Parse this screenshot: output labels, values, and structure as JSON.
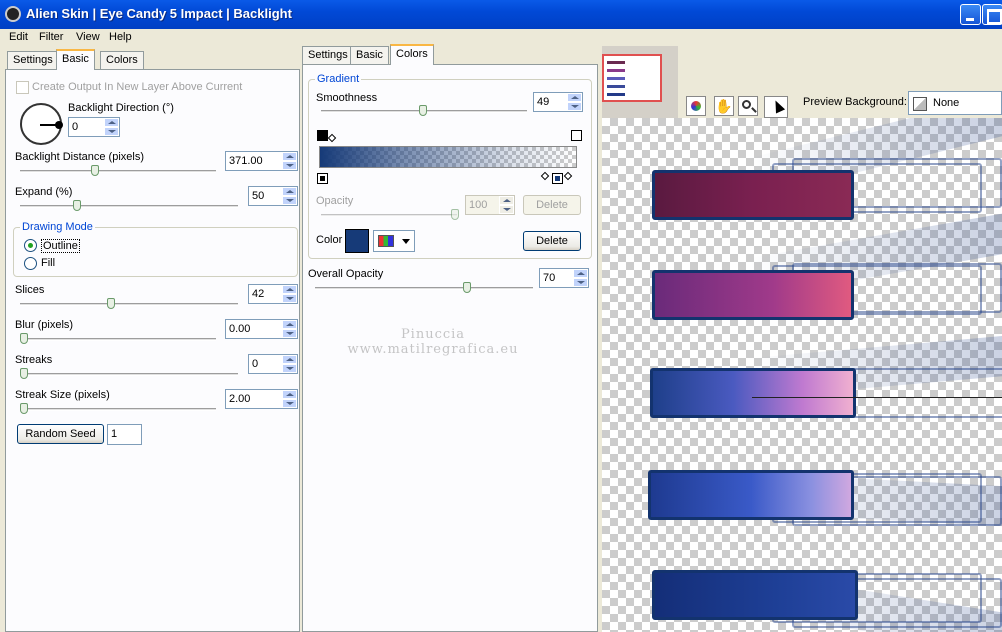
{
  "window": {
    "title": "Alien Skin  |  Eye Candy 5 Impact  |  Backlight"
  },
  "menu": [
    "Edit",
    "Filter",
    "View",
    "Help"
  ],
  "left_tabs": [
    "Settings",
    "Basic",
    "Colors"
  ],
  "right_tabs": [
    "Settings",
    "Basic",
    "Colors"
  ],
  "basic": {
    "create_output_label": "Create Output In New Layer Above Current",
    "direction_label": "Backlight Direction (°)",
    "direction_value": "0",
    "distance_label": "Backlight Distance (pixels)",
    "distance_value": "371.00",
    "expand_label": "Expand (%)",
    "expand_value": "50",
    "drawing_mode_title": "Drawing Mode",
    "outline_label": "Outline",
    "fill_label": "Fill",
    "slices_label": "Slices",
    "slices_value": "42",
    "blur_label": "Blur (pixels)",
    "blur_value": "0.00",
    "streaks_label": "Streaks",
    "streaks_value": "0",
    "streak_size_label": "Streak Size (pixels)",
    "streak_size_value": "2.00",
    "random_seed_label": "Random Seed",
    "random_seed_value": "1"
  },
  "colors": {
    "gradient_title": "Gradient",
    "smoothness_label": "Smoothness",
    "smoothness_value": "49",
    "opacity_label": "Opacity",
    "opacity_value": "100",
    "delete_disabled_label": "Delete",
    "color_label": "Color",
    "color_swatch": "#163a78",
    "delete_label": "Delete",
    "overall_opacity_label": "Overall Opacity",
    "overall_opacity_value": "70"
  },
  "preview": {
    "background_label": "Preview Background:",
    "background_value": "None"
  },
  "watermark": {
    "line1": "Pinuccia",
    "line2": "www.matilregrafica.eu"
  },
  "accent_colors": {
    "title_bar": "#0054e3",
    "active_tab": "#f9b744",
    "bar_blue": "#13336e"
  }
}
